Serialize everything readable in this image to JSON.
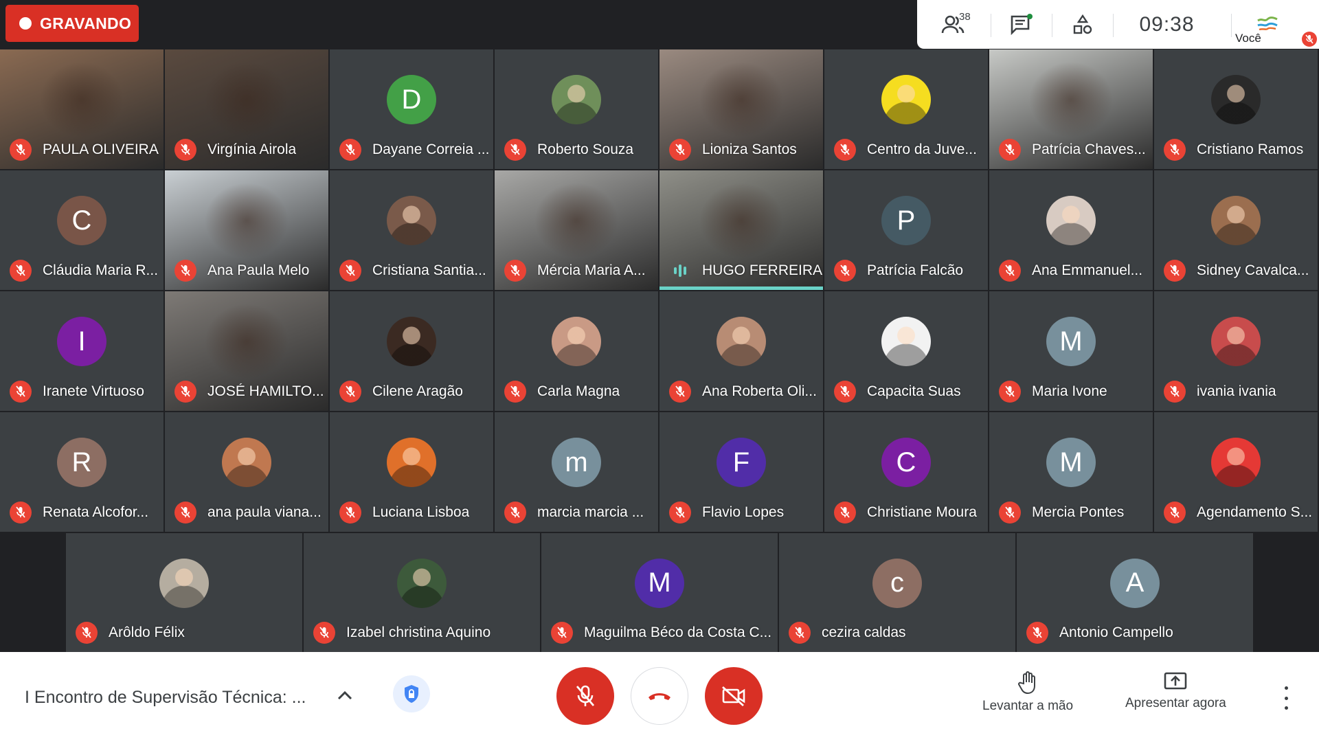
{
  "recording": {
    "label": "GRAVANDO",
    "color": "#d93025"
  },
  "topbar": {
    "participants_count": "38",
    "time": "09:38",
    "self_label": "Você",
    "icons": [
      "people-icon",
      "chat-icon",
      "activities-icon"
    ]
  },
  "grid": {
    "rows": [
      [
        {
          "name": "PAULA OLIVEIRA",
          "kind": "video",
          "bg": "#8a6a52"
        },
        {
          "name": "Virgínia Airola",
          "kind": "video",
          "bg": "#5a4a3f"
        },
        {
          "name": "Dayane Correia ...",
          "kind": "initial",
          "initial": "D",
          "color": "#43a047"
        },
        {
          "name": "Roberto Souza",
          "kind": "photo-avatar",
          "color": "#6f8f5a"
        },
        {
          "name": "Lioniza Santos",
          "kind": "video",
          "bg": "#9a8a80"
        },
        {
          "name": "Centro da Juve...",
          "kind": "photo-avatar",
          "color": "#f5dd20"
        },
        {
          "name": "Patrícia Chaves...",
          "kind": "video",
          "bg": "#c7c9c6"
        },
        {
          "name": "Cristiano Ramos",
          "kind": "photo-avatar",
          "color": "#2a2a2a"
        }
      ],
      [
        {
          "name": "Cláudia Maria R...",
          "kind": "initial",
          "initial": "C",
          "color": "#795548"
        },
        {
          "name": "Ana Paula Melo",
          "kind": "video",
          "bg": "#c9cfd3"
        },
        {
          "name": "Cristiana Santia...",
          "kind": "photo-avatar",
          "color": "#7a5a4a"
        },
        {
          "name": "Mércia Maria A...",
          "kind": "video",
          "bg": "#a8a8a6"
        },
        {
          "name": "HUGO FERREIRA",
          "kind": "video",
          "bg": "#8f8f88",
          "speaking": true
        },
        {
          "name": "Patrícia Falcão",
          "kind": "initial",
          "initial": "P",
          "color": "#455a64"
        },
        {
          "name": "Ana Emmanuel...",
          "kind": "photo-avatar",
          "color": "#d8cbc2"
        },
        {
          "name": "Sidney Cavalca...",
          "kind": "photo-avatar",
          "color": "#9b6e4f"
        }
      ],
      [
        {
          "name": "Iranete Virtuoso",
          "kind": "initial",
          "initial": "I",
          "color": "#7b1fa2"
        },
        {
          "name": "JOSÉ HAMILTO...",
          "kind": "video",
          "bg": "#7e7a76"
        },
        {
          "name": "Cilene Aragão",
          "kind": "photo-avatar",
          "color": "#3b2a22"
        },
        {
          "name": "Carla Magna",
          "kind": "photo-avatar",
          "color": "#c99a85"
        },
        {
          "name": "Ana Roberta Oli...",
          "kind": "photo-avatar",
          "color": "#b88c74"
        },
        {
          "name": "Capacita Suas",
          "kind": "photo-avatar",
          "color": "#f2f2f2"
        },
        {
          "name": "Maria Ivone",
          "kind": "initial",
          "initial": "M",
          "color": "#78909c"
        },
        {
          "name": "ivania ivania",
          "kind": "photo-avatar",
          "color": "#c84c4c"
        }
      ],
      [
        {
          "name": "Renata Alcofor...",
          "kind": "initial",
          "initial": "R",
          "color": "#8d6e63"
        },
        {
          "name": "ana paula viana...",
          "kind": "photo-avatar",
          "color": "#c07850"
        },
        {
          "name": "Luciana Lisboa",
          "kind": "photo-avatar",
          "color": "#e0702a"
        },
        {
          "name": "marcia marcia ...",
          "kind": "initial",
          "initial": "m",
          "color": "#78909c"
        },
        {
          "name": "Flavio Lopes",
          "kind": "initial",
          "initial": "F",
          "color": "#512da8"
        },
        {
          "name": "Christiane Moura",
          "kind": "initial",
          "initial": "C",
          "color": "#7b1fa2"
        },
        {
          "name": "Mercia Pontes",
          "kind": "initial",
          "initial": "M",
          "color": "#78909c"
        },
        {
          "name": "Agendamento S...",
          "kind": "photo-avatar",
          "color": "#e53935"
        }
      ]
    ],
    "last_row": [
      {
        "name": "Arôldo Félix",
        "kind": "photo-avatar",
        "color": "#b5ada0"
      },
      {
        "name": "Izabel christina Aquino",
        "kind": "photo-avatar",
        "color": "#3d5a3b"
      },
      {
        "name": "Maguilma Béco da Costa C...",
        "kind": "initial",
        "initial": "M",
        "color": "#512da8"
      },
      {
        "name": "cezira caldas",
        "kind": "initial",
        "initial": "c",
        "color": "#8d6e63"
      },
      {
        "name": "Antonio Campello",
        "kind": "initial",
        "initial": "A",
        "color": "#78909c"
      }
    ]
  },
  "bottombar": {
    "meeting_title": "I Encontro de Supervisão Técnica: ...",
    "raise_hand_label": "Levantar a mão",
    "present_label": "Apresentar agora",
    "mic_color": "#d93025",
    "cam_color": "#d93025",
    "hangup_color": "#d93025"
  }
}
